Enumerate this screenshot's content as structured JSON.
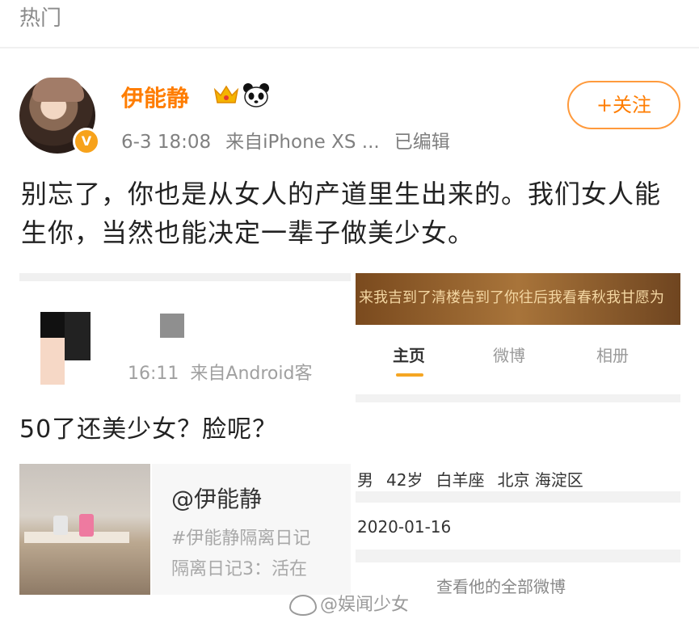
{
  "header": {
    "title": "热门"
  },
  "post": {
    "author": {
      "name": "伊能静",
      "badges": [
        "crown-icon",
        "panda-icon"
      ],
      "verified_badge": "V"
    },
    "meta": {
      "time": "6-3 18:08",
      "source": "来自iPhone XS ...",
      "edited": "已编辑"
    },
    "follow_button": "+关注",
    "text": "别忘了，你也是从女人的产道里生出来的。我们女人能生你，当然也能决定一辈子做美少女。"
  },
  "quoted": {
    "meta_time": "16:11",
    "meta_source": "来自Android客",
    "text": "50了还美少女？脸呢？",
    "link_card": {
      "title": "@伊能静",
      "line1": "#伊能静隔离日记",
      "line2": "隔离日记3：活在"
    }
  },
  "profile_screenshot": {
    "banner_text": "来我吉到了清楼告到了你往后我看春秋我甘愿为",
    "tabs": [
      "主页",
      "微博",
      "相册"
    ],
    "info": [
      "男",
      "42岁",
      "白羊座",
      "北京 海淀区"
    ],
    "date": "2020-01-16",
    "view_all": "查看他的全部微博"
  },
  "watermark": "@娱闻少女",
  "colors": {
    "accent_orange": "#ff7d00",
    "follow_border": "#ff9a3c",
    "verified_badge": "#f7a21b",
    "tab_underline": "#f5a623"
  }
}
